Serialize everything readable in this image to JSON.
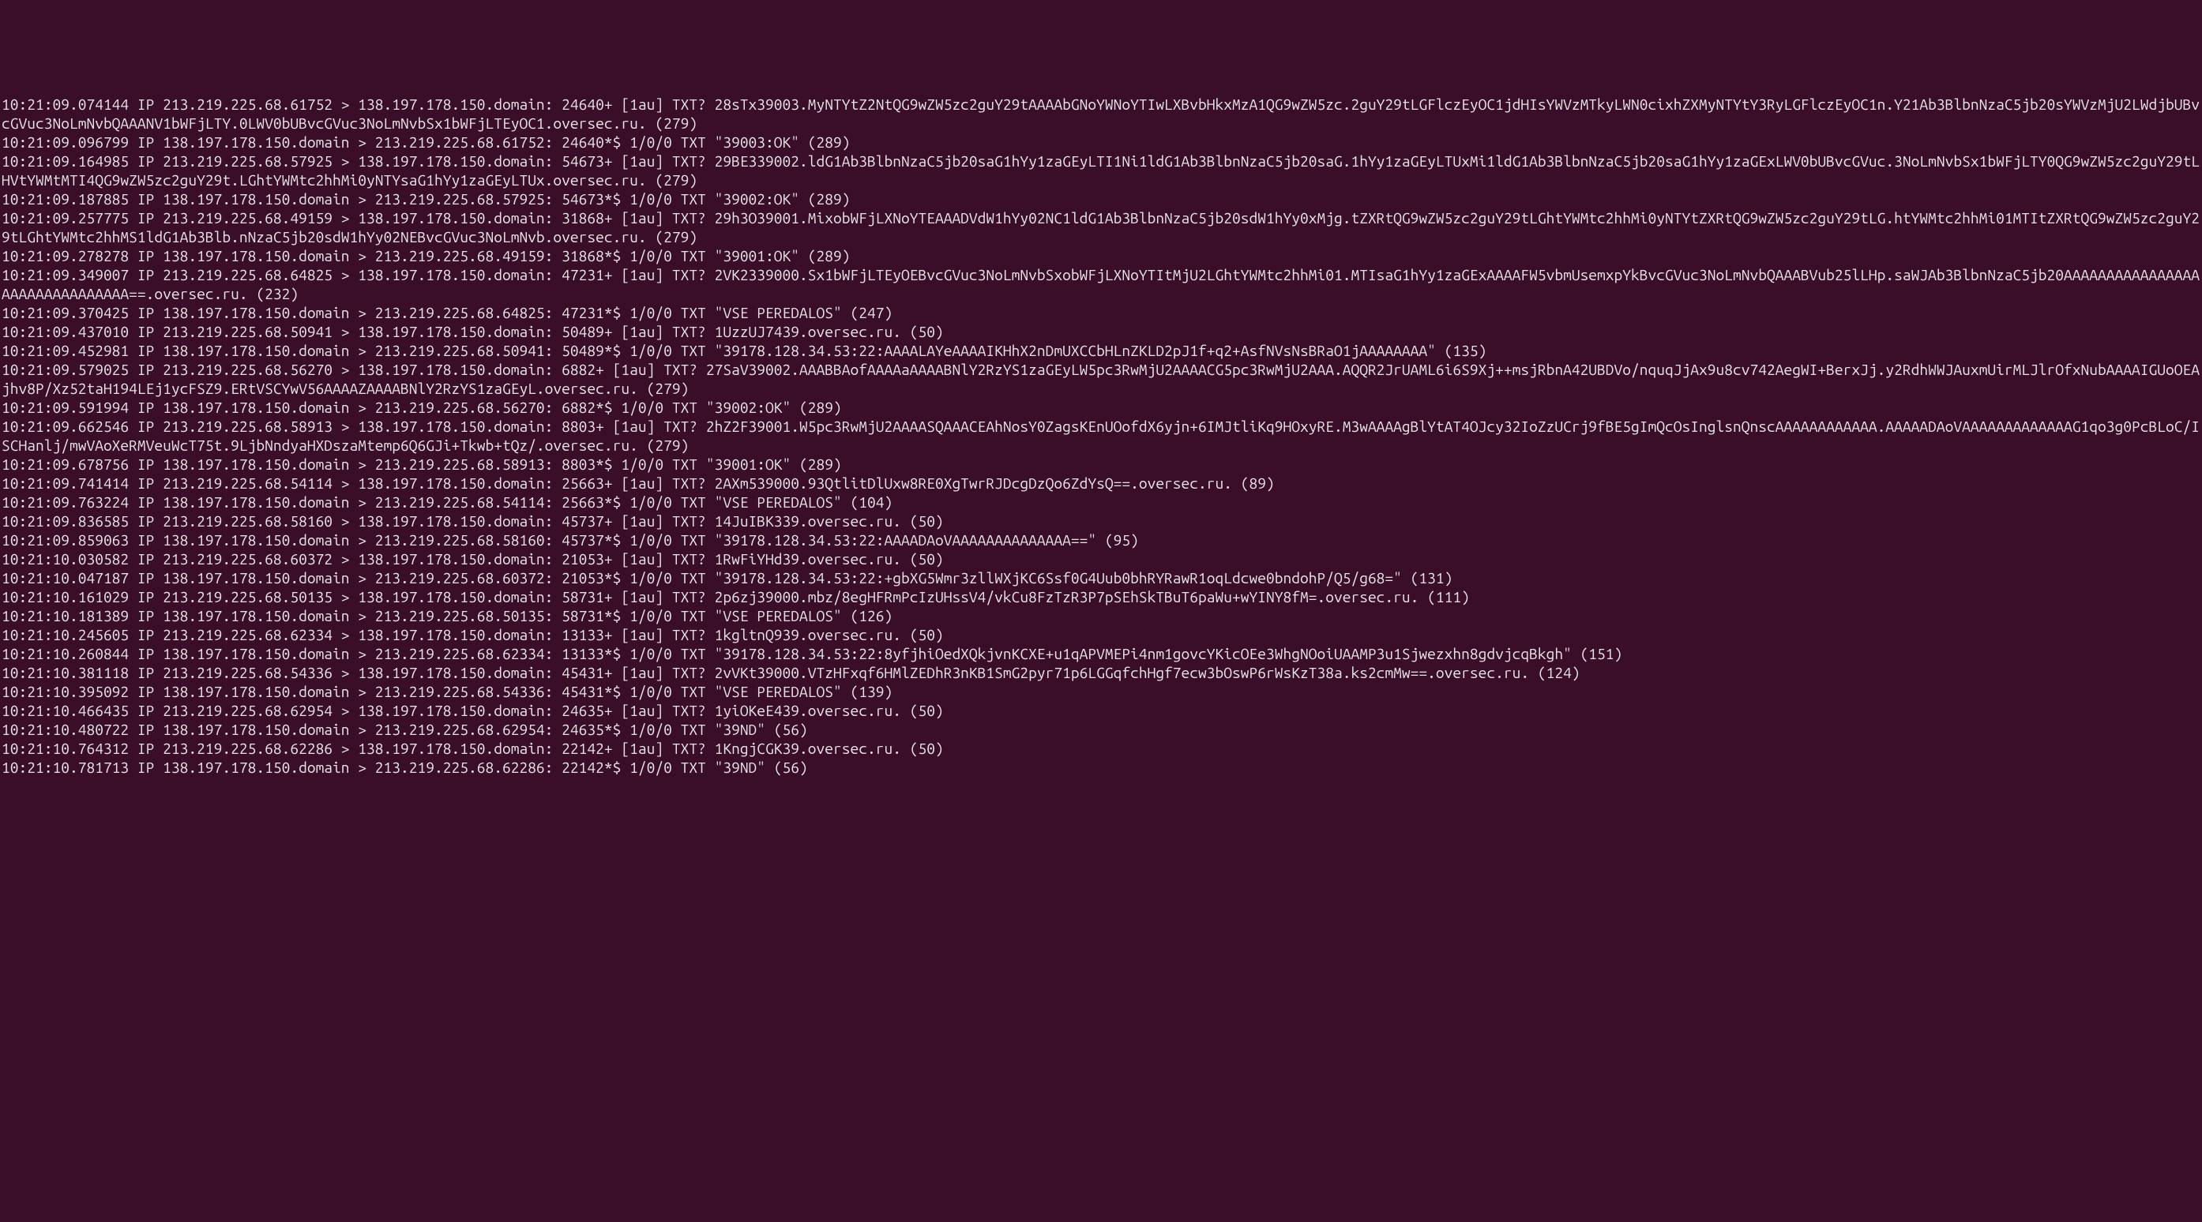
{
  "terminal": {
    "lines": [
      "10:21:09.074144 IP 213.219.225.68.61752 > 138.197.178.150.domain: 24640+ [1au] TXT? 28sTx39003.MyNTYtZ2NtQG9wZW5zc2guY29tAAAAbGNoYWNoYTIwLXBvbHkxMzA1QG9wZW5zc.2guY29tLGFlczEyOC1jdHIsYWVzMTkyLWN0cixhZXMyNTYtY3RyLGFlczEyOC1n.Y21Ab3BlbnNzaC5jb20sYWVzMjU2LWdjbUBvcGVuc3NoLmNvbQAAANV1bWFjLTY.0LWV0bUBvcGVuc3NoLmNvbSx1bWFjLTEyOC1.oversec.ru. (279)",
      "10:21:09.096799 IP 138.197.178.150.domain > 213.219.225.68.61752: 24640*$ 1/0/0 TXT \"39003:OK\" (289)",
      "10:21:09.164985 IP 213.219.225.68.57925 > 138.197.178.150.domain: 54673+ [1au] TXT? 29BE339002.ldG1Ab3BlbnNzaC5jb20saG1hYy1zaGEyLTI1Ni1ldG1Ab3BlbnNzaC5jb20saG.1hYy1zaGEyLTUxMi1ldG1Ab3BlbnNzaC5jb20saG1hYy1zaGExLWV0bUBvcGVuc.3NoLmNvbSx1bWFjLTY0QG9wZW5zc2guY29tLHVtYWMtMTI4QG9wZW5zc2guY29t.LGhtYWMtc2hhMi0yNTYsaG1hYy1zaGEyLTUx.oversec.ru. (279)",
      "10:21:09.187885 IP 138.197.178.150.domain > 213.219.225.68.57925: 54673*$ 1/0/0 TXT \"39002:OK\" (289)",
      "10:21:09.257775 IP 213.219.225.68.49159 > 138.197.178.150.domain: 31868+ [1au] TXT? 29h3O39001.MixobWFjLXNoYTEAAADVdW1hYy02NC1ldG1Ab3BlbnNzaC5jb20sdW1hYy0xMjg.tZXRtQG9wZW5zc2guY29tLGhtYWMtc2hhMi0yNTYtZXRtQG9wZW5zc2guY29tLG.htYWMtc2hhMi01MTItZXRtQG9wZW5zc2guY29tLGhtYWMtc2hhMS1ldG1Ab3Blb.nNzaC5jb20sdW1hYy02NEBvcGVuc3NoLmNvb.oversec.ru. (279)",
      "10:21:09.278278 IP 138.197.178.150.domain > 213.219.225.68.49159: 31868*$ 1/0/0 TXT \"39001:OK\" (289)",
      "10:21:09.349007 IP 213.219.225.68.64825 > 138.197.178.150.domain: 47231+ [1au] TXT? 2VK2339000.Sx1bWFjLTEyOEBvcGVuc3NoLmNvbSxobWFjLXNoYTItMjU2LGhtYWMtc2hhMi01.MTIsaG1hYy1zaGExAAAAFW5vbmUsemxpYkBvcGVuc3NoLmNvbQAAABVub25lLHp.saWJAb3BlbnNzaC5jb20AAAAAAAAAAAAAAAAAAAAAAAAAAAAAAA==.oversec.ru. (232)",
      "10:21:09.370425 IP 138.197.178.150.domain > 213.219.225.68.64825: 47231*$ 1/0/0 TXT \"VSE PEREDALOS\" (247)",
      "10:21:09.437010 IP 213.219.225.68.50941 > 138.197.178.150.domain: 50489+ [1au] TXT? 1UzzUJ7439.oversec.ru. (50)",
      "10:21:09.452981 IP 138.197.178.150.domain > 213.219.225.68.50941: 50489*$ 1/0/0 TXT \"39178.128.34.53:22:AAAALAYeAAAAIKHhX2nDmUXCCbHLnZKLD2pJ1f+q2+AsfNVsNsBRaO1jAAAAAAAA\" (135)",
      "10:21:09.579025 IP 213.219.225.68.56270 > 138.197.178.150.domain: 6882+ [1au] TXT? 27SaV39002.AAABBAofAAAAaAAAABNlY2RzYS1zaGEyLW5pc3RwMjU2AAAACG5pc3RwMjU2AAA.AQQR2JrUAML6i6S9Xj++msjRbnA42UBDVo/nquqJjAx9u8cv742AegWI+BerxJj.y2RdhWWJAuxmUirMLJlrOfxNubAAAAIGUoOEAjhv8P/Xz52taH194LEj1ycFSZ9.ERtVSCYwV56AAAAZAAAABNlY2RzYS1zaGEyL.oversec.ru. (279)",
      "10:21:09.591994 IP 138.197.178.150.domain > 213.219.225.68.56270: 6882*$ 1/0/0 TXT \"39002:OK\" (289)",
      "10:21:09.662546 IP 213.219.225.68.58913 > 138.197.178.150.domain: 8803+ [1au] TXT? 2hZ2F39001.W5pc3RwMjU2AAAASQAAACEAhNosY0ZagsKEnUOofdX6yjn+6IMJtliKq9HOxyRE.M3wAAAAgBlYtAT4OJcy32IoZzUCrj9fBE5gImQcOsInglsnQnscAAAAAAAAAAAA.AAAAADAoVAAAAAAAAAAAAAG1qo3g0PcBLoC/ISCHanlj/mwVAoXeRMVeuWcT75t.9LjbNndyaHXDszaMtemp6Q6GJi+Tkwb+tQz/.oversec.ru. (279)",
      "10:21:09.678756 IP 138.197.178.150.domain > 213.219.225.68.58913: 8803*$ 1/0/0 TXT \"39001:OK\" (289)",
      "10:21:09.741414 IP 213.219.225.68.54114 > 138.197.178.150.domain: 25663+ [1au] TXT? 2AXm539000.93QtlitDlUxw8RE0XgTwrRJDcgDzQo6ZdYsQ==.oversec.ru. (89)",
      "10:21:09.763224 IP 138.197.178.150.domain > 213.219.225.68.54114: 25663*$ 1/0/0 TXT \"VSE PEREDALOS\" (104)",
      "10:21:09.836585 IP 213.219.225.68.58160 > 138.197.178.150.domain: 45737+ [1au] TXT? 14JuIBK339.oversec.ru. (50)",
      "10:21:09.859063 IP 138.197.178.150.domain > 213.219.225.68.58160: 45737*$ 1/0/0 TXT \"39178.128.34.53:22:AAAADAoVAAAAAAAAAAAAAA==\" (95)",
      "10:21:10.030582 IP 213.219.225.68.60372 > 138.197.178.150.domain: 21053+ [1au] TXT? 1RwFiYHd39.oversec.ru. (50)",
      "10:21:10.047187 IP 138.197.178.150.domain > 213.219.225.68.60372: 21053*$ 1/0/0 TXT \"39178.128.34.53:22:+gbXG5Wmr3zllWXjKC6Ssf0G4Uub0bhRYRawR1oqLdcwe0bndohP/Q5/g68=\" (131)",
      "10:21:10.161029 IP 213.219.225.68.50135 > 138.197.178.150.domain: 58731+ [1au] TXT? 2p6zj39000.mbz/8egHFRmPcIzUHssV4/vkCu8FzTzR3P7pSEhSkTBuT6paWu+wYINY8fM=.oversec.ru. (111)",
      "10:21:10.181389 IP 138.197.178.150.domain > 213.219.225.68.50135: 58731*$ 1/0/0 TXT \"VSE PEREDALOS\" (126)",
      "10:21:10.245605 IP 213.219.225.68.62334 > 138.197.178.150.domain: 13133+ [1au] TXT? 1kgltnQ939.oversec.ru. (50)",
      "10:21:10.260844 IP 138.197.178.150.domain > 213.219.225.68.62334: 13133*$ 1/0/0 TXT \"39178.128.34.53:22:8yfjhiOedXQkjvnKCXE+u1qAPVMEPi4nm1govcYKicOEe3WhgNOoiUAAMP3u1Sjwezxhn8gdvjcqBkgh\" (151)",
      "10:21:10.381118 IP 213.219.225.68.54336 > 138.197.178.150.domain: 45431+ [1au] TXT? 2vVKt39000.VTzHFxqf6HMlZEDhR3nKB1SmG2pyr71p6LGGqfchHgf7ecw3bOswP6rWsKzT38a.ks2cmMw==.oversec.ru. (124)",
      "10:21:10.395092 IP 138.197.178.150.domain > 213.219.225.68.54336: 45431*$ 1/0/0 TXT \"VSE PEREDALOS\" (139)",
      "10:21:10.466435 IP 213.219.225.68.62954 > 138.197.178.150.domain: 24635+ [1au] TXT? 1yiOKeE439.oversec.ru. (50)",
      "10:21:10.480722 IP 138.197.178.150.domain > 213.219.225.68.62954: 24635*$ 1/0/0 TXT \"39ND\" (56)",
      "10:21:10.764312 IP 213.219.225.68.62286 > 138.197.178.150.domain: 22142+ [1au] TXT? 1KngjCGK39.oversec.ru. (50)",
      "10:21:10.781713 IP 138.197.178.150.domain > 213.219.225.68.62286: 22142*$ 1/0/0 TXT \"39ND\" (56)"
    ]
  }
}
